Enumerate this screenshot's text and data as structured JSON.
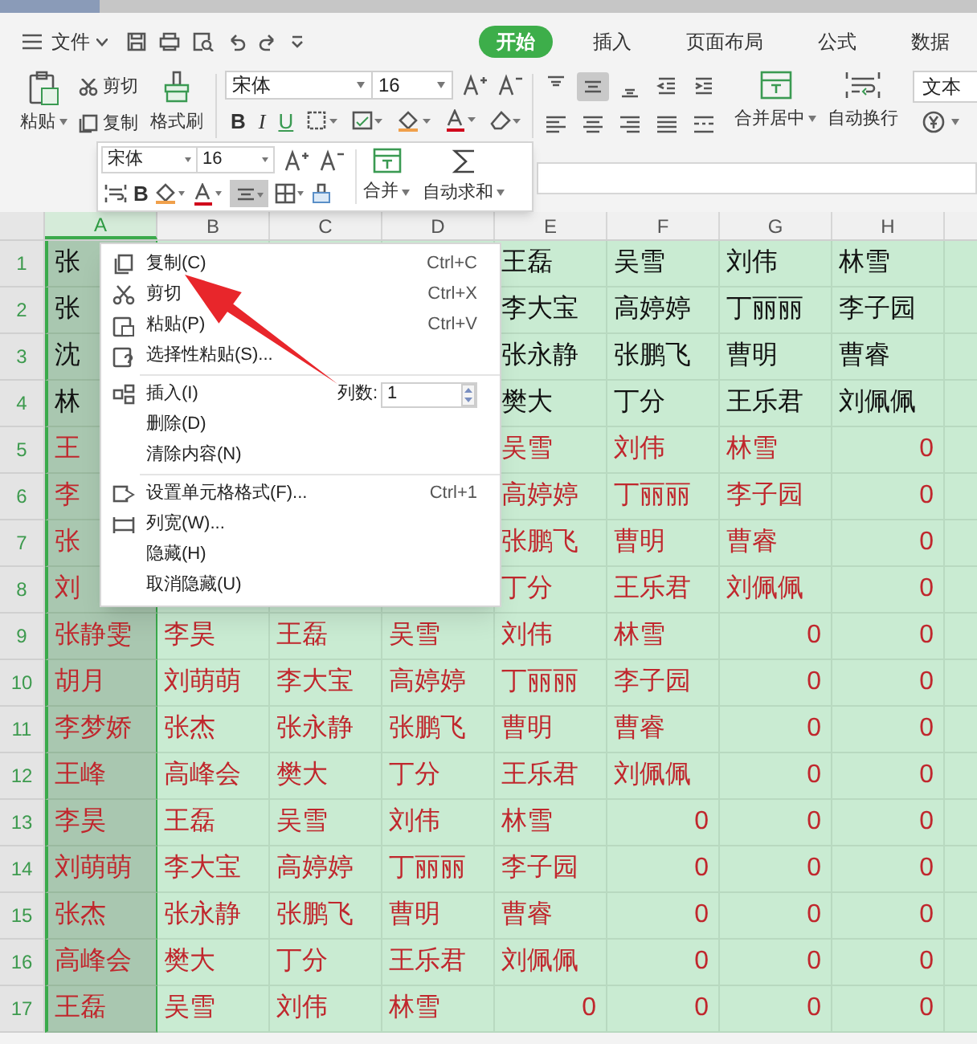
{
  "menu_bar": {
    "file_label": "文件",
    "tabs": [
      {
        "label": "开始",
        "selected": true
      },
      {
        "label": "插入",
        "selected": false
      },
      {
        "label": "页面布局",
        "selected": false
      },
      {
        "label": "公式",
        "selected": false
      },
      {
        "label": "数据",
        "selected": false
      }
    ]
  },
  "ribbon": {
    "paste": "粘贴",
    "cut": "剪切",
    "copy": "复制",
    "format_painter": "格式刷",
    "font_name": "宋体",
    "font_size": "16",
    "bold": "B",
    "italic": "I",
    "underline": "U",
    "center_align_selected": true,
    "merge": "合并居中",
    "wrap": "自动换行",
    "number_format": "文本"
  },
  "mini_toolbar": {
    "font_name": "宋体",
    "font_size": "16",
    "bold": "B",
    "center_align_selected": true,
    "merge": "合并",
    "autosum": "自动求和"
  },
  "sheet": {
    "columns": [
      {
        "label": "A",
        "selected": true
      },
      {
        "label": "B",
        "selected": false
      },
      {
        "label": "C",
        "selected": false
      },
      {
        "label": "D",
        "selected": false
      },
      {
        "label": "E",
        "selected": false
      },
      {
        "label": "F",
        "selected": false
      },
      {
        "label": "G",
        "selected": false
      },
      {
        "label": "H",
        "selected": false
      }
    ],
    "rows": [
      {
        "number": "1",
        "highlighted": false,
        "cells": [
          "张",
          null,
          null,
          null,
          "王磊",
          "吴雪",
          "刘伟",
          "林雪"
        ]
      },
      {
        "number": "2",
        "highlighted": false,
        "cells": [
          "张",
          null,
          null,
          null,
          "李大宝",
          "高婷婷",
          "丁丽丽",
          "李子园"
        ]
      },
      {
        "number": "3",
        "highlighted": false,
        "cells": [
          "沈",
          null,
          null,
          null,
          "张永静",
          "张鹏飞",
          "曹明",
          "曹睿"
        ]
      },
      {
        "number": "4",
        "highlighted": false,
        "cells": [
          "林",
          null,
          null,
          null,
          "樊大",
          "丁分",
          "王乐君",
          "刘佩佩"
        ]
      },
      {
        "number": "5",
        "highlighted": true,
        "cells": [
          "王",
          null,
          null,
          null,
          "吴雪",
          "刘伟",
          "林雪",
          {
            "number": "0"
          }
        ]
      },
      {
        "number": "6",
        "highlighted": true,
        "cells": [
          "李",
          null,
          null,
          null,
          "高婷婷",
          "丁丽丽",
          "李子园",
          {
            "number": "0"
          }
        ]
      },
      {
        "number": "7",
        "highlighted": true,
        "cells": [
          "张",
          null,
          null,
          null,
          "张鹏飞",
          "曹明",
          "曹睿",
          {
            "number": "0"
          }
        ]
      },
      {
        "number": "8",
        "highlighted": true,
        "cells": [
          "刘",
          null,
          null,
          null,
          "丁分",
          "王乐君",
          "刘佩佩",
          {
            "number": "0"
          }
        ]
      },
      {
        "number": "9",
        "highlighted": true,
        "cells": [
          "张静雯",
          "李昊",
          "王磊",
          "吴雪",
          "刘伟",
          "林雪",
          {
            "number": "0"
          },
          {
            "number": "0"
          }
        ]
      },
      {
        "number": "10",
        "highlighted": true,
        "cells": [
          "胡月",
          "刘萌萌",
          "李大宝",
          "高婷婷",
          "丁丽丽",
          "李子园",
          {
            "number": "0"
          },
          {
            "number": "0"
          }
        ]
      },
      {
        "number": "11",
        "highlighted": true,
        "cells": [
          "李梦娇",
          "张杰",
          "张永静",
          "张鹏飞",
          "曹明",
          "曹睿",
          {
            "number": "0"
          },
          {
            "number": "0"
          }
        ]
      },
      {
        "number": "12",
        "highlighted": true,
        "cells": [
          "王峰",
          "高峰会",
          "樊大",
          "丁分",
          "王乐君",
          "刘佩佩",
          {
            "number": "0"
          },
          {
            "number": "0"
          }
        ]
      },
      {
        "number": "13",
        "highlighted": true,
        "cells": [
          "李昊",
          "王磊",
          "吴雪",
          "刘伟",
          "林雪",
          {
            "number": "0"
          },
          {
            "number": "0"
          },
          {
            "number": "0"
          }
        ]
      },
      {
        "number": "14",
        "highlighted": true,
        "cells": [
          "刘萌萌",
          "李大宝",
          "高婷婷",
          "丁丽丽",
          "李子园",
          {
            "number": "0"
          },
          {
            "number": "0"
          },
          {
            "number": "0"
          }
        ]
      },
      {
        "number": "15",
        "highlighted": true,
        "cells": [
          "张杰",
          "张永静",
          "张鹏飞",
          "曹明",
          "曹睿",
          {
            "number": "0"
          },
          {
            "number": "0"
          },
          {
            "number": "0"
          }
        ]
      },
      {
        "number": "16",
        "highlighted": true,
        "cells": [
          "高峰会",
          "樊大",
          "丁分",
          "王乐君",
          "刘佩佩",
          {
            "number": "0"
          },
          {
            "number": "0"
          },
          {
            "number": "0"
          }
        ]
      },
      {
        "number": "17",
        "highlighted": true,
        "cells": [
          "王磊",
          "吴雪",
          "刘伟",
          "林雪",
          {
            "number": "0"
          },
          {
            "number": "0"
          },
          {
            "number": "0"
          },
          {
            "number": "0"
          }
        ]
      }
    ]
  },
  "context_menu": {
    "items": [
      {
        "kind": "item",
        "label": "复制(C)",
        "shortcut": "Ctrl+C"
      },
      {
        "kind": "item",
        "label": "剪切",
        "shortcut": "Ctrl+X"
      },
      {
        "kind": "item",
        "label": "粘贴(P)",
        "shortcut": "Ctrl+V"
      },
      {
        "kind": "item",
        "label": "选择性粘贴(S)..."
      },
      {
        "kind": "separator"
      },
      {
        "kind": "count",
        "label": "插入(I)",
        "count_label": "列数:",
        "count_value": "1"
      },
      {
        "kind": "item",
        "label": "删除(D)"
      },
      {
        "kind": "item",
        "label": "清除内容(N)"
      },
      {
        "kind": "separator"
      },
      {
        "kind": "item",
        "label": "设置单元格格式(F)...",
        "shortcut": "Ctrl+1"
      },
      {
        "kind": "item",
        "label": "列宽(W)..."
      },
      {
        "kind": "item",
        "label": "隐藏(H)"
      },
      {
        "kind": "item",
        "label": "取消隐藏(U)"
      }
    ]
  }
}
